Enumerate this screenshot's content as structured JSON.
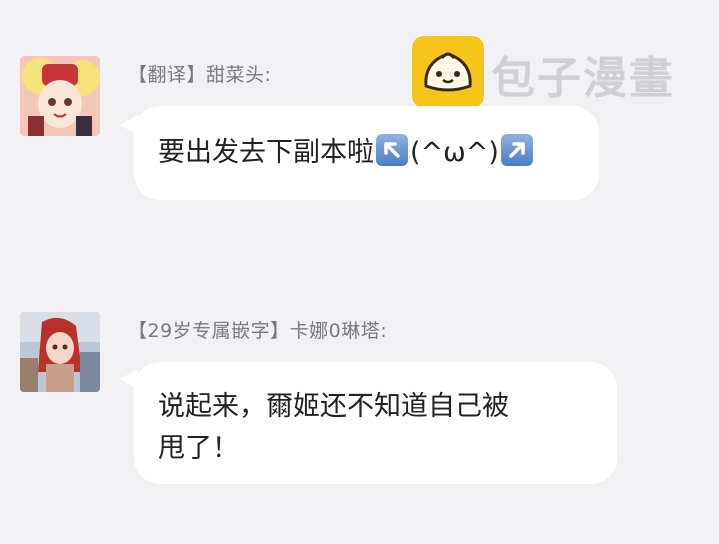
{
  "watermark": {
    "text": "包子漫畫"
  },
  "messages": [
    {
      "sender": "【翻译】甜菜头:",
      "text_before": "要出发去下副本啦",
      "middle": "(^ω^)"
    },
    {
      "sender": "【29岁专属嵌字】卡娜0琳塔:",
      "line1": "说起来，爾姬还不知道自己被",
      "line2": "甩了！"
    }
  ],
  "icons": [
    "avatar-image",
    "arrow-up-left-icon",
    "arrow-up-right-icon",
    "bun-logo-icon"
  ]
}
